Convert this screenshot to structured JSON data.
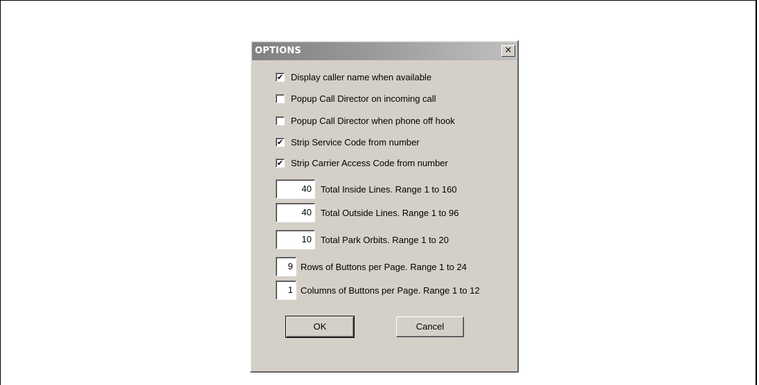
{
  "dialog": {
    "title": "OPTIONS",
    "close_glyph": "×",
    "check_glyph": "✔",
    "checkboxes": [
      {
        "label": "Display caller name when available",
        "checked": true
      },
      {
        "label": "Popup Call Director on incoming call",
        "checked": false
      },
      {
        "label": "Popup Call Director when phone off hook",
        "checked": false
      },
      {
        "label": "Strip Service Code from number",
        "checked": true
      },
      {
        "label": "Strip Carrier Access Code from number",
        "checked": true
      }
    ],
    "fields": [
      {
        "value": "40",
        "label": "Total Inside Lines. Range 1 to 160"
      },
      {
        "value": "40",
        "label": "Total Outside Lines. Range 1 to 96"
      },
      {
        "value": "10",
        "label": "Total Park Orbits. Range 1 to 20"
      },
      {
        "value": "9",
        "label": "Rows of Buttons per Page. Range 1 to 24"
      },
      {
        "value": "1",
        "label": "Columns of Buttons per Page. Range 1 to 12"
      }
    ],
    "ok_label": "OK",
    "cancel_label": "Cancel"
  }
}
